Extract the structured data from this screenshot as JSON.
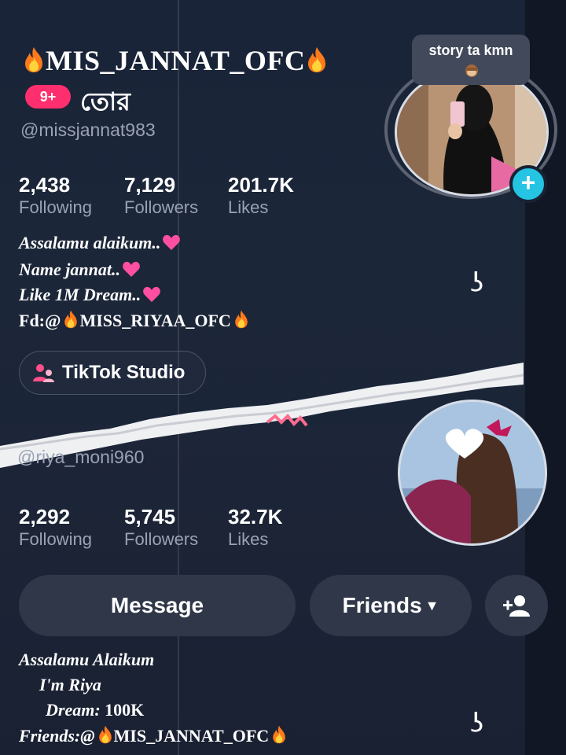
{
  "top_profile": {
    "display_name": "MIS_JANNAT_OFC",
    "notification_badge": "9+",
    "bangla_tag": "তোর",
    "username": "@missjannat983",
    "stats": [
      {
        "value": "2,438",
        "label": "Following"
      },
      {
        "value": "7,129",
        "label": "Followers"
      },
      {
        "value": "201.7K",
        "label": "Likes"
      }
    ],
    "bio_lines": [
      "Assalamu alaikum..",
      "Name jannat..",
      "Like 1M Dream.."
    ],
    "bio_friend_prefix": "Fd:@",
    "bio_friend_name": "MISS_RIYAA_OFC",
    "studio_button": "TikTok Studio",
    "note_text": "story ta kmn"
  },
  "bottom_profile": {
    "username": "@riya_moni960",
    "stats": [
      {
        "value": "2,292",
        "label": "Following"
      },
      {
        "value": "5,745",
        "label": "Followers"
      },
      {
        "value": "32.7K",
        "label": "Likes"
      }
    ],
    "message_button": "Message",
    "friends_button": "Friends",
    "bio_lines": [
      "Assalamu Alaikum",
      "I'm Riya"
    ],
    "dream_label": "Dream:",
    "dream_value": "100K",
    "friends_prefix": "Friends:@",
    "friends_name": "MIS_JANNAT_OFC"
  },
  "decor_glyph": "ʖ",
  "colors": {
    "background": "#182235",
    "notif_badge": "#ff2e6e",
    "follow_plus": "#25c4e3",
    "heart": "#ff4fa3",
    "flame": "#ff7a1a"
  }
}
